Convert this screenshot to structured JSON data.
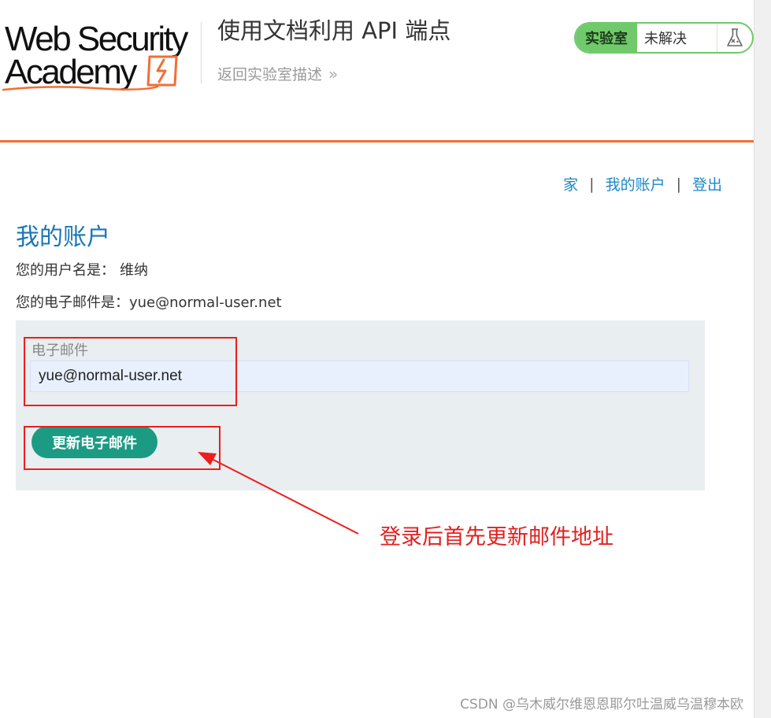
{
  "logo": {
    "line1": "Web Security",
    "line2": "Academy"
  },
  "header": {
    "lab_title": "使用文档利用 API 端点",
    "back_link": "返回实验室描述",
    "back_chevron": "»",
    "status_tag": "实验室",
    "status_state": "未解决",
    "status_icon": "flask-icon"
  },
  "nav": {
    "home": "家",
    "my_account": "我的账户",
    "logout": "登出",
    "separator": "|"
  },
  "account": {
    "title": "我的账户",
    "username_label": "您的用户名是：",
    "username": "维纳",
    "email_label": "您的电子邮件是：",
    "email": "yue@normal-user.net"
  },
  "form": {
    "email_field_label": "电子邮件",
    "email_value": "yue@normal-user.net",
    "submit_label": "更新电子邮件"
  },
  "annotation": {
    "text": "登录后首先更新邮件地址",
    "color": "#e02020"
  },
  "watermark": "CSDN @乌木威尔维恩恩耶尔吐温威乌温穆本欧",
  "colors": {
    "accent_orange": "#f16f34",
    "link_blue": "#1e88c7",
    "title_blue": "#1a77b5",
    "button_teal": "#1b9b84",
    "status_green": "#70c96b"
  }
}
